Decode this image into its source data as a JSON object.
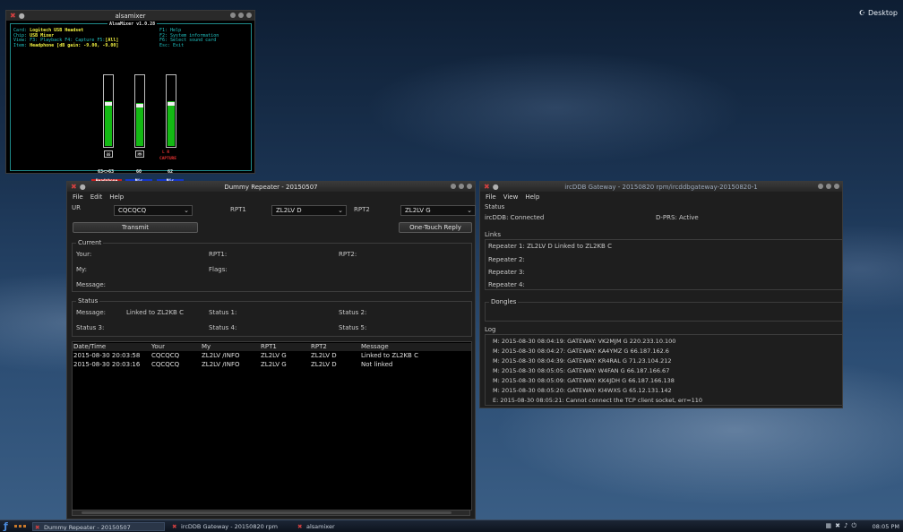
{
  "desktop": {
    "label": "Desktop",
    "icon": "desktop-icon"
  },
  "alsamixer": {
    "window_title": "alsamixer",
    "header": "AlsaMixer v1.0.28",
    "card": "Logitech USB Headset",
    "chip": "USB Mixer",
    "view": "F3: Playback  F4: Capture  F5:",
    "view_all": "[All]",
    "item": "Headphone [dB gain: -9.00, -9.00]",
    "labels": {
      "card": "Card:",
      "chip": "Chip:",
      "view": "View:",
      "item": "Item:"
    },
    "keys": [
      "F1:  Help",
      "F2:  System information",
      "F6:  Select sound card",
      "Esc: Exit"
    ],
    "channels": [
      {
        "name": "Headphone",
        "value": "63<>63",
        "level": 0.63,
        "active": true,
        "box": "00"
      },
      {
        "name": "Mic",
        "value": "60",
        "level": 0.6,
        "active": false,
        "box": "MM"
      },
      {
        "name": "Mic",
        "value": "62",
        "level": 0.62,
        "active": false,
        "box": ""
      }
    ],
    "capture_label": "CAPTURE",
    "capture_lr": "L  R"
  },
  "dummy": {
    "window_title": "Dummy Repeater - 20150507",
    "menu": [
      "File",
      "Edit",
      "Help"
    ],
    "ur_label": "UR",
    "ur_value": "CQCQCQ",
    "rpt1_label": "RPT1",
    "rpt1_value": "ZL2LV D",
    "rpt2_label": "RPT2",
    "rpt2_value": "ZL2LV G",
    "transmit": "Transmit",
    "one_touch": "One-Touch Reply",
    "current": {
      "title": "Current",
      "your": "Your:",
      "rpt1": "RPT1:",
      "rpt2": "RPT2:",
      "my": "My:",
      "flags": "Flags:",
      "message": "Message:"
    },
    "status": {
      "title": "Status",
      "message_label": "Message:",
      "message_value": "Linked to ZL2KB  C",
      "status1": "Status 1:",
      "status2": "Status 2:",
      "status3": "Status 3:",
      "status4": "Status 4:",
      "status5": "Status 5:"
    },
    "columns": [
      "Date/Time",
      "Your",
      "My",
      "RPT1",
      "RPT2",
      "Message"
    ],
    "rows": [
      [
        "2015-08-30 20:03:58",
        "CQCQCQ",
        "ZL2LV  /INFO",
        "ZL2LV  G",
        "ZL2LV  D",
        "Linked to ZL2KB  C"
      ],
      [
        "2015-08-30 20:03:16",
        "CQCQCQ",
        "ZL2LV  /INFO",
        "ZL2LV  G",
        "ZL2LV  D",
        "Not linked"
      ]
    ]
  },
  "gateway": {
    "window_title": "ircDDB Gateway - 20150820 rpm/ircddbgateway-20150820-1",
    "menu": [
      "File",
      "View",
      "Help"
    ],
    "status_title": "Status",
    "ircddb": "ircDDB:  Connected",
    "dprs": "D-PRS:  Active",
    "links_title": "Links",
    "repeaters": [
      "Repeater 1:  ZL2LV  D  Linked to  ZL2KB  C",
      "Repeater 2:",
      "Repeater 3:",
      "Repeater 4:"
    ],
    "dongles_title": "Dongles",
    "log_title": "Log",
    "log": [
      "M: 2015-08-30 08:04:19: GATEWAY: VK2MJM G 220.233.10.100",
      "M: 2015-08-30 08:04:27: GATEWAY: KA4YMZ G 66.187.162.6",
      "M: 2015-08-30 08:04:39: GATEWAY: KR4RAL G 71.23.104.212",
      "M: 2015-08-30 08:05:05: GATEWAY: W4FAN  G 66.187.166.67",
      "M: 2015-08-30 08:05:09: GATEWAY: KK4JDH G 66.187.166.138",
      "M: 2015-08-30 08:05:20: GATEWAY: KI4WXS G 65.12.131.142",
      "E: 2015-08-30 08:05:21: Cannot connect the TCP client socket, err=110"
    ]
  },
  "taskbar": {
    "tasks": [
      "Dummy Repeater - 20150507",
      "ircDDB Gateway - 20150820 rpm",
      "alsamixer"
    ],
    "clock": "08:05 PM"
  },
  "colors": {
    "accent": "#14b914",
    "mixer_name_bg": "#1436c8",
    "mixer_active_bg": "#c81e1e"
  }
}
